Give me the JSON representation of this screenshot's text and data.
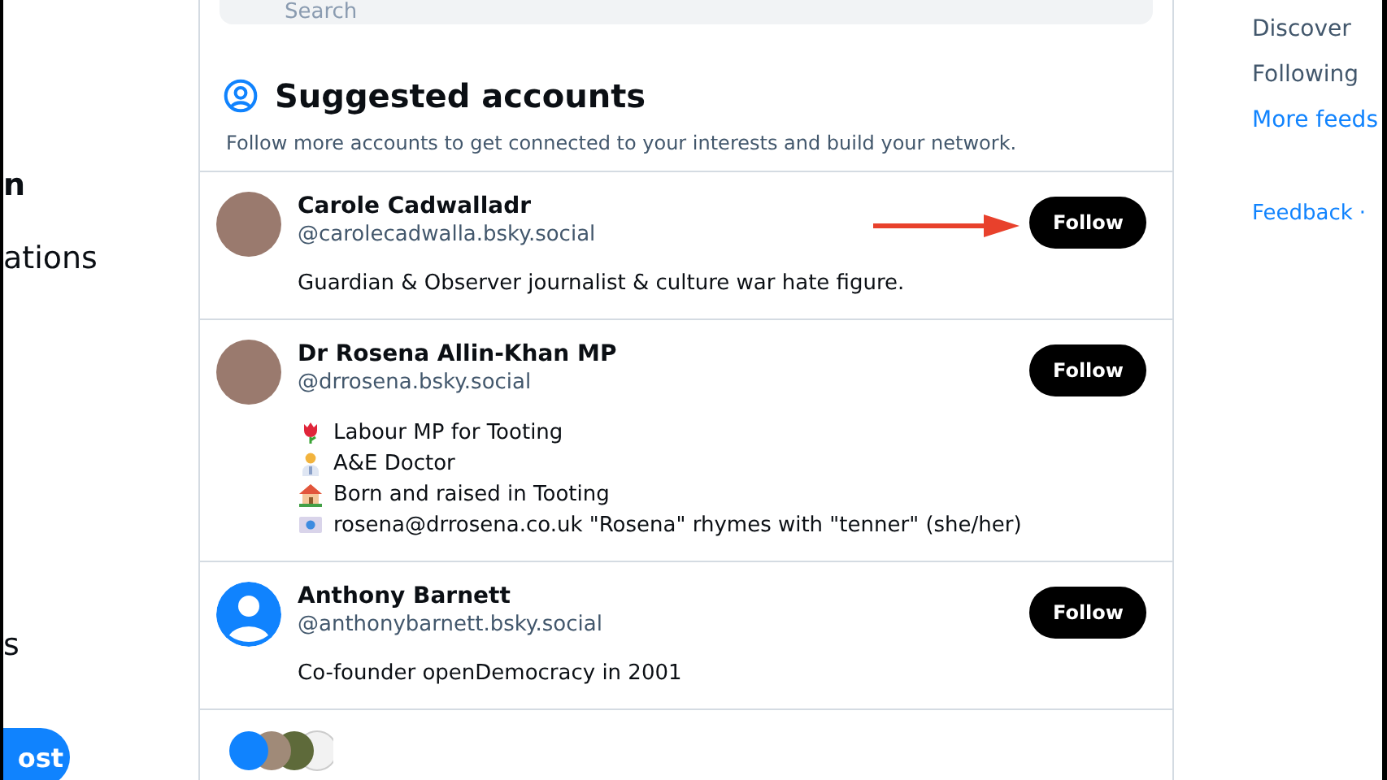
{
  "left_nav": {
    "items": [
      {
        "label": "n",
        "selected": true
      },
      {
        "label": "ations",
        "selected": false
      },
      {
        "label": "s",
        "selected": false
      }
    ],
    "post_button": "ost"
  },
  "search": {
    "placeholder": "Search"
  },
  "suggested": {
    "title": "Suggested accounts",
    "subtitle": "Follow more accounts to get connected to your interests and build your network.",
    "accounts": [
      {
        "name": "Carole Cadwalladr",
        "handle": "@carolecadwalla.bsky.social",
        "kind": "photo",
        "bio": [
          {
            "kind": "plain",
            "text": "Guardian & Observer journalist & culture war hate figure."
          }
        ],
        "button": "Follow",
        "annotated": true
      },
      {
        "name": "Dr Rosena Allin-Khan MP",
        "handle": "@drrosena.bsky.social",
        "kind": "photo",
        "bio": [
          {
            "kind": "flower",
            "text": "Labour MP for Tooting"
          },
          {
            "kind": "doctor",
            "text": "A&E Doctor"
          },
          {
            "kind": "house",
            "text": "Born and raised in Tooting"
          },
          {
            "kind": "envelope",
            "text": "rosena@drrosena.co.uk \"Rosena\" rhymes with \"tenner\" (she/her)"
          }
        ],
        "button": "Follow",
        "annotated": false
      },
      {
        "name": "Anthony Barnett",
        "handle": "@anthonybarnett.bsky.social",
        "kind": "default",
        "bio": [
          {
            "kind": "plain",
            "text": "Co-founder openDemocracy in 2001"
          }
        ],
        "button": "Follow",
        "annotated": false
      }
    ]
  },
  "right_nav": {
    "feeds": [
      "Discover",
      "Following"
    ],
    "more_link": "More feeds",
    "footer_links": [
      "Feedback",
      "·"
    ]
  }
}
